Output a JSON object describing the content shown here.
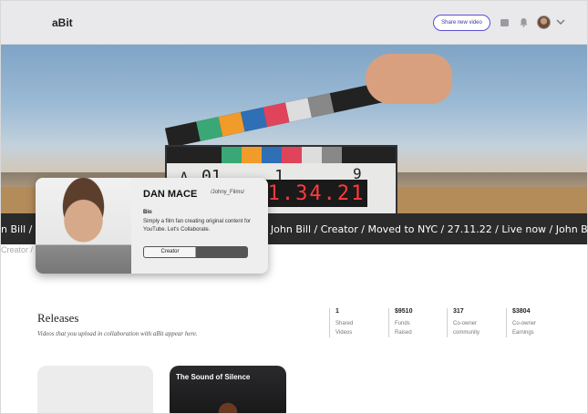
{
  "header": {
    "logo": "aBit",
    "share_button": "Share new video",
    "icons": [
      "wallet-icon",
      "bell-icon",
      "avatar",
      "chevron-down-icon"
    ]
  },
  "hero": {
    "clapper_digits": "1.34.21",
    "clapper_labels": [
      "A",
      "01",
      "1",
      "9"
    ]
  },
  "ticker": {
    "text": "n Bill / Creator / Moved to NYC / 27.11.22 / Live now / John Bill / Creator / Moved to NYC / 27.11.22 / Live now / John Bill /",
    "faded": "Creator /"
  },
  "profile": {
    "name": "DAN MACE",
    "handle": "/Johny_Films/",
    "bio_heading": "Bio",
    "bio": "Simply a film fan creating original content for YouTube. Let's Collaborate.",
    "role": "Creator"
  },
  "releases": {
    "title": "Releases",
    "subtitle": "Videos that you upload in collaboration with aBit appear here.",
    "stats": [
      {
        "value": "1",
        "label": "Shared Videos"
      },
      {
        "value": "$9510",
        "label": "Funds Raised"
      },
      {
        "value": "317",
        "label": "Co-owner community"
      },
      {
        "value": "$3804",
        "label": "Co-owner Earnings"
      }
    ],
    "tiles": [
      {
        "title": ""
      },
      {
        "title": "The Sound of Silence"
      }
    ]
  }
}
